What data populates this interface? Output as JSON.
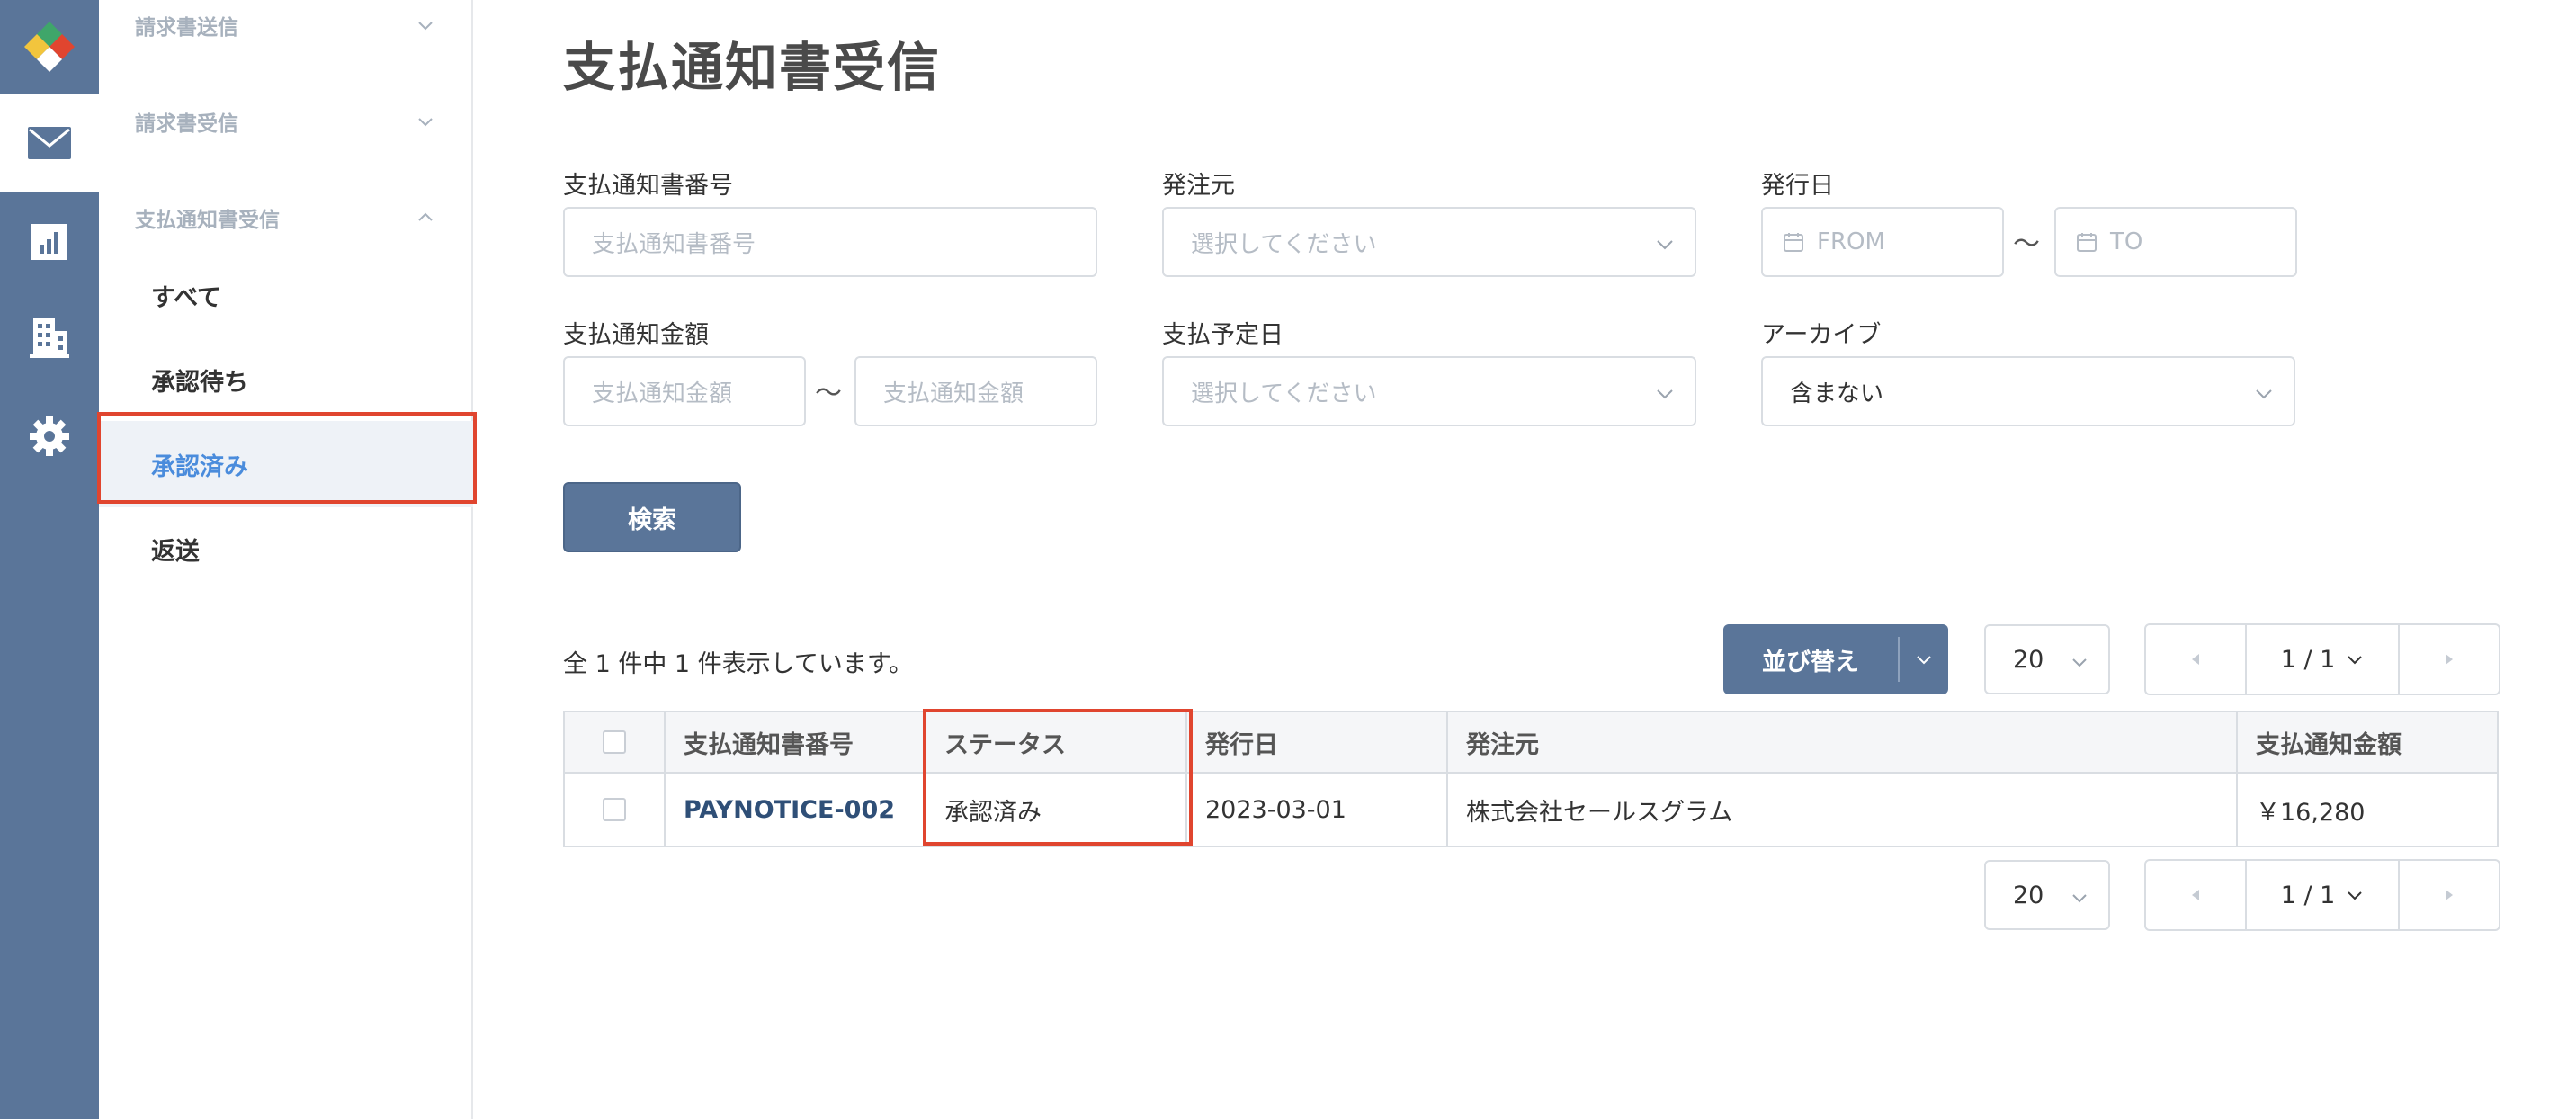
{
  "rail": {
    "items": [
      {
        "icon": "logo-icon"
      },
      {
        "icon": "mail-icon",
        "active": true
      },
      {
        "icon": "chart-icon"
      },
      {
        "icon": "building-icon"
      },
      {
        "icon": "gear-icon"
      }
    ]
  },
  "subnav": {
    "groups": [
      {
        "label": "請求書送信",
        "expanded": false
      },
      {
        "label": "請求書受信",
        "expanded": false
      },
      {
        "label": "支払通知書受信",
        "expanded": true
      }
    ],
    "items": [
      {
        "label": "すべて"
      },
      {
        "label": "承認待ち"
      },
      {
        "label": "承認済み",
        "active": true
      },
      {
        "label": "返送"
      }
    ]
  },
  "page": {
    "title": "支払通知書受信"
  },
  "filters": {
    "number_label": "支払通知書番号",
    "number_placeholder": "支払通知書番号",
    "orderer_label": "発注元",
    "orderer_placeholder": "選択してください",
    "issue_date_label": "発行日",
    "date_from_placeholder": "FROM",
    "date_to_placeholder": "TO",
    "range_separator": "〜",
    "amount_label": "支払通知金額",
    "amount_from_placeholder": "支払通知金額",
    "amount_to_placeholder": "支払通知金額",
    "due_date_label": "支払予定日",
    "due_date_placeholder": "選択してください",
    "archive_label": "アーカイブ",
    "archive_value": "含まない",
    "search_button": "検索"
  },
  "results": {
    "count_text": "全 1 件中 1 件表示しています。",
    "sort_button": "並び替え",
    "per_page": "20",
    "page_indicator": "1 / 1"
  },
  "table": {
    "columns": [
      "支払通知書番号",
      "ステータス",
      "発行日",
      "発注元",
      "支払通知金額"
    ],
    "rows": [
      {
        "number": "PAYNOTICE-002",
        "status": "承認済み",
        "issue_date": "2023-03-01",
        "orderer": "株式会社セールスグラム",
        "amount": "￥16,280"
      }
    ]
  },
  "colors": {
    "rail": "#5a7599",
    "accent": "#4a8cdc",
    "highlight": "#e0452f",
    "link": "#2f4f77"
  }
}
